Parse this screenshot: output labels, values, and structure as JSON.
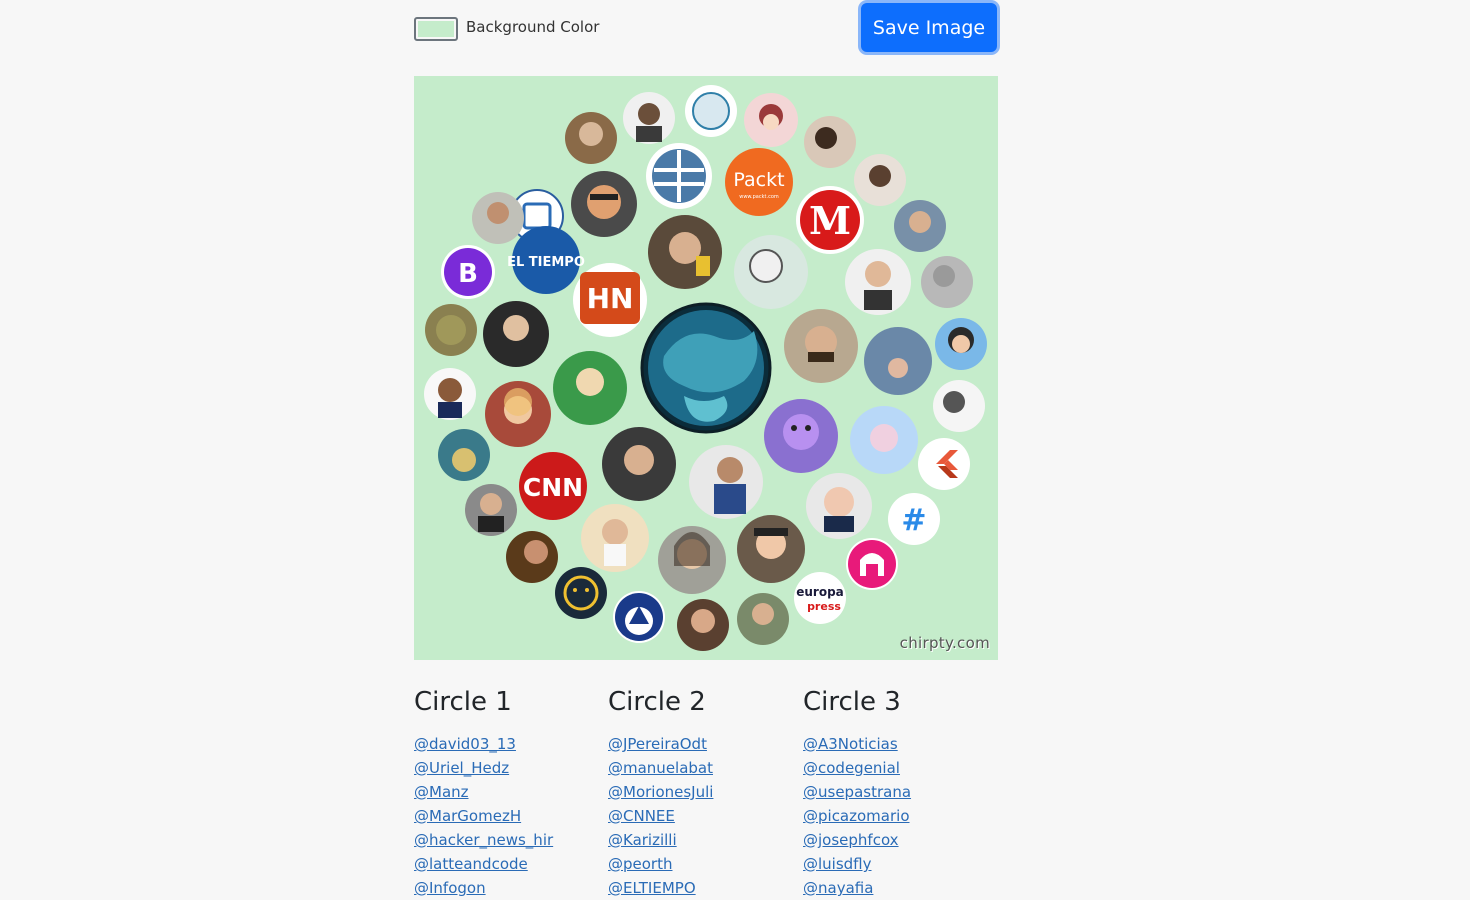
{
  "toolbar": {
    "background_color_label": "Background Color",
    "background_color_value": "#c5eccb",
    "save_label": "Save Image"
  },
  "canvas": {
    "watermark": "chirpty.com",
    "logos": {
      "eltiempo": "EL TIEMPO",
      "hn": "HN",
      "packt": "Packt",
      "packt_sub": "www.packt.com",
      "m": "M",
      "b": "B",
      "cnn": "CNN",
      "europa1": "europa",
      "europa2": "press",
      "hash": "#"
    }
  },
  "circles": [
    {
      "title": "Circle 1",
      "handles": [
        "@david03_13",
        "@Uriel_Hedz",
        "@Manz",
        "@MarGomezH",
        "@hacker_news_hir",
        "@latteandcode",
        "@Infogon"
      ]
    },
    {
      "title": "Circle 2",
      "handles": [
        "@JPereiraOdt",
        "@manuelabat",
        "@MorionesJuli",
        "@CNNEE",
        "@Karizilli",
        "@peorth",
        "@ELTIEMPO"
      ]
    },
    {
      "title": "Circle 3",
      "handles": [
        "@A3Noticias",
        "@codegenial",
        "@usepastrana",
        "@picazomario",
        "@josephfcox",
        "@luisdfly",
        "@nayafia"
      ]
    }
  ]
}
